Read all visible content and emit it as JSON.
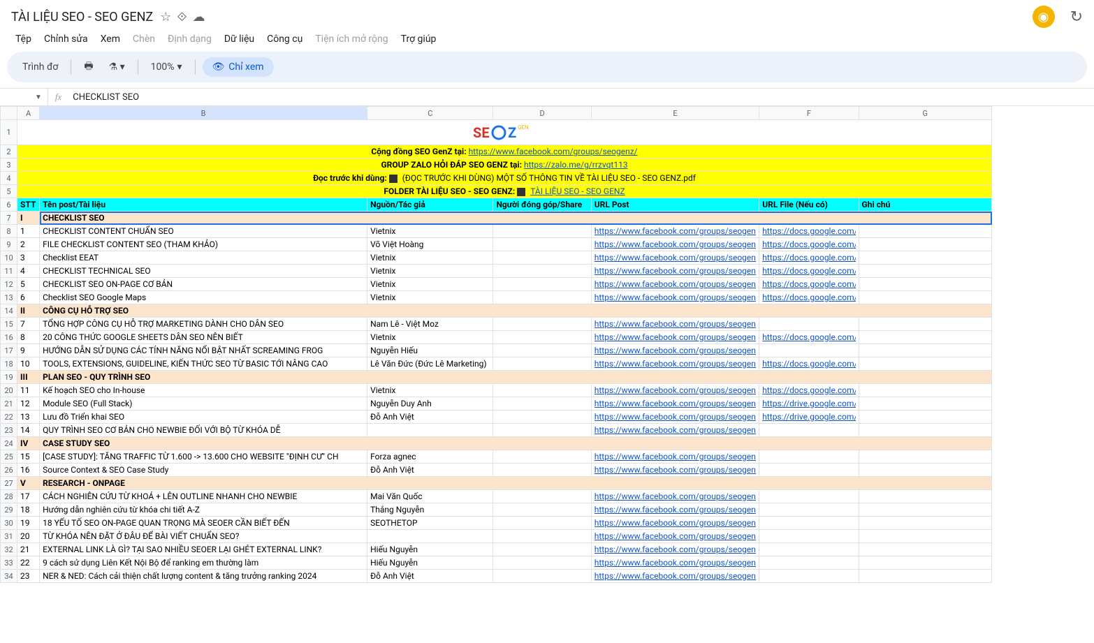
{
  "doc": {
    "title": "TÀI LIỆU SEO - SEO GENZ"
  },
  "menus": {
    "file": "Tệp",
    "edit": "Chỉnh sửa",
    "view": "Xem",
    "insert": "Chèn",
    "format": "Định dạng",
    "data": "Dữ liệu",
    "tools": "Công cụ",
    "extensions": "Tiện ích mở rộng",
    "help": "Trợ giúp"
  },
  "toolbar": {
    "presentation": "Trình đơ",
    "zoom": "100%",
    "viewonly": "Chỉ xem"
  },
  "fx": {
    "value": "CHECKLIST SEO"
  },
  "cols": [
    "A",
    "B",
    "C",
    "D",
    "E",
    "F",
    "G"
  ],
  "banner": {
    "community_pre": "Cộng đồng SEO GenZ tại: ",
    "community_link": "https://www.facebook.com/groups/seogenz/",
    "zalo_pre": "GROUP ZALO HỎI ĐÁP SEO GENZ tại: ",
    "zalo_link": "https://zalo.me/g/rrzvqt113",
    "read_pre": "Đọc trước khi dùng:",
    "read_file": "(ĐỌC TRƯỚC KHI DÙNG) MỘT SỐ THÔNG TIN VỀ TÀI LIỆU SEO - SEO GENZ.pdf",
    "folder_pre": "FOLDER TÀI LIỆU SEO - SEO GENZ:",
    "folder_link": "TÀI LIỆU SEO - SEO GENZ"
  },
  "headers": {
    "stt": "STT",
    "title": "Tên post/Tài liệu",
    "source": "Nguồn/Tác giả",
    "contrib": "Người đóng góp/Share",
    "urlpost": "URL Post",
    "urlfile": "URL File (Nếu có)",
    "note": "Ghi chú"
  },
  "sections": {
    "s1": {
      "num": "I",
      "title": "CHECKLIST SEO"
    },
    "s2": {
      "num": "II",
      "title": "CÔNG CỤ HỖ TRỢ SEO"
    },
    "s3": {
      "num": "III",
      "title": "PLAN SEO - QUY TRÌNH SEO"
    },
    "s4": {
      "num": "IV",
      "title": "CASE STUDY SEO"
    },
    "s5": {
      "num": "V",
      "title": "RESEARCH - ONPAGE"
    }
  },
  "rows": [
    {
      "n": "1",
      "t": "CHECKLIST CONTENT CHUẨN SEO",
      "a": "Vietnix",
      "u": "https://www.facebook.com/groups/seogenz/",
      "f": "https://docs.google.com/sp"
    },
    {
      "n": "2",
      "t": "FILE CHECKLIST CONTENT SEO (THAM KHẢO)",
      "a": "Võ Việt Hoàng",
      "u": "https://www.facebook.com/groups/seogenz/",
      "f": "https://docs.google.com/sp"
    },
    {
      "n": "3",
      "t": "Checklist EEAT",
      "a": "Vietnix",
      "u": "https://www.facebook.com/groups/seogenz/",
      "f": "https://docs.google.com/sp"
    },
    {
      "n": "4",
      "t": "CHECKLIST TECHNICAL SEO",
      "a": "Vietnix",
      "u": "https://www.facebook.com/groups/seogenz/",
      "f": "https://docs.google.com/sp"
    },
    {
      "n": "5",
      "t": "CHECKLIST SEO ON-PAGE CƠ BẢN",
      "a": "Vietnix",
      "u": "https://www.facebook.com/groups/seogenz/",
      "f": "https://docs.google.com/sp"
    },
    {
      "n": "6",
      "t": "Checklist SEO Google Maps",
      "a": "Vietnix",
      "u": "https://www.facebook.com/groups/seogenz/",
      "f": "https://docs.google.com/sp"
    },
    {
      "n": "7",
      "t": "TỔNG HỢP CÔNG CỤ HỖ TRỢ MARKETING DÀNH CHO DÂN SEO",
      "a": "Nam Lê - Việt Moz",
      "u": "https://www.facebook.com/groups/seogenz/",
      "f": ""
    },
    {
      "n": "8",
      "t": "20 CÔNG THỨC GOOGLE SHEETS DÂN SEO NÊN BIẾT",
      "a": "Vietnix",
      "u": "https://www.facebook.com/groups/seogenz/",
      "f": "https://docs.google.com/sp"
    },
    {
      "n": "9",
      "t": "HƯỚNG DẪN SỬ DỤNG CÁC TÍNH NĂNG NỔI BẬT NHẤT SCREAMING FROG",
      "a": "Nguyễn Hiếu",
      "u": "https://www.facebook.com/groups/seogenz/",
      "f": ""
    },
    {
      "n": "10",
      "t": "TOOLS, EXTENSIONS, GUIDELINE, KIẾN THỨC SEO TỪ BASIC TỚI NÂNG CAO",
      "a": "Lê Văn Đức (Đức Lê Marketing)",
      "u": "https://www.facebook.com/groups/seogenz/",
      "f": "https://docs.google.com/sp"
    },
    {
      "n": "11",
      "t": "Kế hoạch SEO cho In-house",
      "a": "Vietnix",
      "u": "https://www.facebook.com/groups/seogenz/",
      "f": "https://docs.google.com/sp"
    },
    {
      "n": "12",
      "t": "Module SEO (Full Stack)",
      "a": "Nguyễn Duy Anh",
      "u": "https://www.facebook.com/groups/seogenz/",
      "f": "https://drive.google.com/fil"
    },
    {
      "n": "13",
      "t": "Lưu đồ Triển khai SEO",
      "a": "Đỗ Anh Việt",
      "u": "https://www.facebook.com/groups/seogenz/",
      "f": "https://drive.google.com/fil"
    },
    {
      "n": "14",
      "t": "QUY TRÌNH SEO CƠ BẢN CHO NEWBIE ĐỐI VỚI BỘ TỪ KHÓA DỄ",
      "a": "",
      "u": "https://www.facebook.com/groups/seogenz/",
      "f": ""
    },
    {
      "n": "15",
      "t": "[CASE STUDY]: TĂNG TRAFFIC TỪ 1.600 -> 13.600 CHO WEBSITE \"ĐỊNH CƯ\" CH",
      "a": "Forza agnec",
      "u": "https://www.facebook.com/groups/seogenz/",
      "f": ""
    },
    {
      "n": "16",
      "t": "Source Context & SEO Case Study",
      "a": "Đỗ Anh Việt",
      "u": "https://www.facebook.com/groups/seogenz/",
      "f": ""
    },
    {
      "n": "17",
      "t": "CÁCH NGHIÊN CỨU TỪ KHOÁ + LÊN OUTLINE NHANH CHO NEWBIE",
      "a": "Mai Văn Quốc",
      "u": "https://www.facebook.com/groups/seogenz/",
      "f": ""
    },
    {
      "n": "18",
      "t": "Hướng dẫn nghiên cứu từ khóa chi tiết A-Z",
      "a": "Thắng Nguyễn",
      "u": "https://www.facebook.com/groups/seogenz/",
      "f": ""
    },
    {
      "n": "19",
      "t": "18 YẾU TỐ SEO ON-PAGE QUAN TRỌNG MÀ SEOER CẦN BIẾT ĐẾN",
      "a": "SEOTHETOP",
      "u": "https://www.facebook.com/groups/seogenz/",
      "f": ""
    },
    {
      "n": "20",
      "t": "TỪ KHÓA NÊN ĐẶT Ở ĐÂU ĐỂ BÀI VIẾT CHUẨN SEO?",
      "a": "",
      "u": "https://www.facebook.com/groups/seogenz/",
      "f": ""
    },
    {
      "n": "21",
      "t": "EXTERNAL LINK LÀ GÌ? TẠI SAO NHIỀU SEOER LẠI GHÉT EXTERNAL LINK?",
      "a": "Hiếu Nguyễn",
      "u": "https://www.facebook.com/groups/seogenz/",
      "f": ""
    },
    {
      "n": "22",
      "t": "9 cách sử dụng Liên Kết Nội Bộ để ranking em thường làm",
      "a": "Hiếu Nguyễn",
      "u": "https://www.facebook.com/groups/seogenz/",
      "f": ""
    },
    {
      "n": "23",
      "t": "NER & NED: Cách cải thiện chất lượng content & tăng trưởng ranking 2024",
      "a": "Đỗ Anh Việt",
      "u": "https://www.facebook.com/groups/seogenz/",
      "f": ""
    }
  ]
}
